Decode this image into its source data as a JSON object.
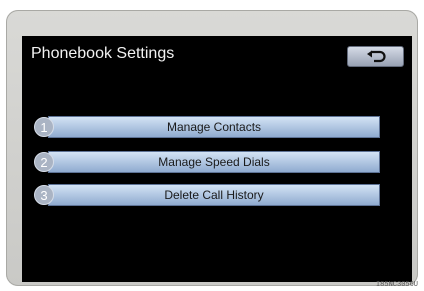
{
  "screen": {
    "title": "Phonebook Settings",
    "back_icon": "return-arrow-icon"
  },
  "menu": [
    {
      "number": "1",
      "label": "Manage Contacts"
    },
    {
      "number": "2",
      "label": "Manage Speed Dials"
    },
    {
      "number": "3",
      "label": "Delete Call History"
    }
  ],
  "image_code": "I85NC3056U",
  "colors": {
    "screen_bg": "#000000",
    "button_gradient_top": "#d3e3f5",
    "button_gradient_bottom": "#90abcf",
    "title_text": "#f2f2f2"
  }
}
